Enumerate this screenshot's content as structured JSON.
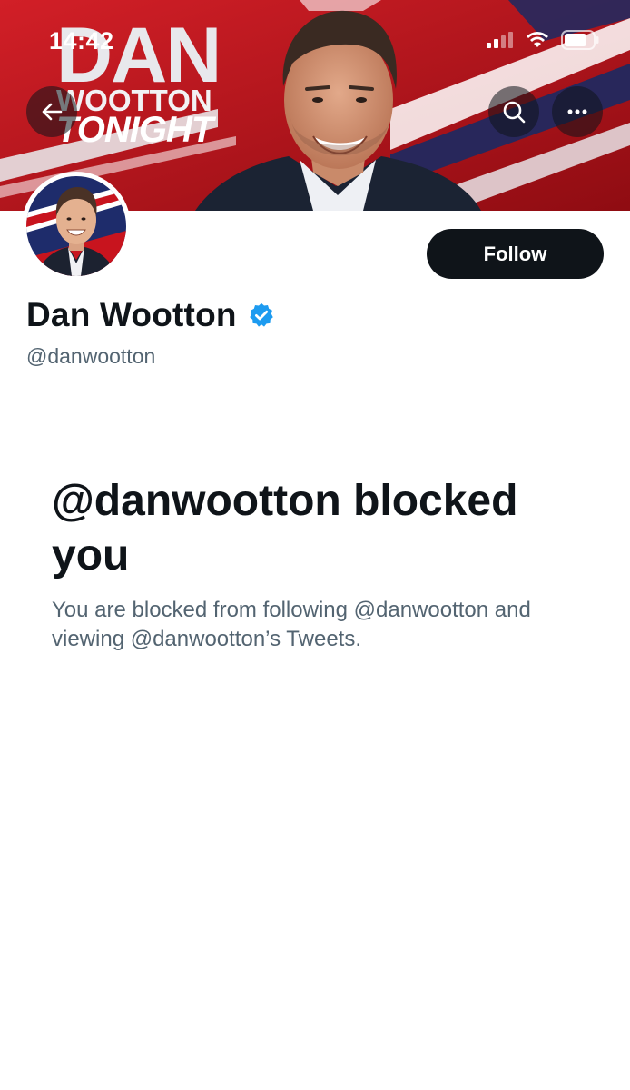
{
  "status_bar": {
    "time": "14:42"
  },
  "banner": {
    "line1": "DAN",
    "line2": "WOOTTON",
    "line3": "TONIGHT"
  },
  "navigation": {
    "back_icon": "arrow-left-icon",
    "search_icon": "search-icon",
    "more_icon": "more-horizontal-icon"
  },
  "profile": {
    "display_name": "Dan Wootton",
    "handle": "@danwootton",
    "verified": true,
    "verified_badge_color": "#1d9bf0",
    "follow_label": "Follow"
  },
  "blocked": {
    "title": "@danwootton blocked you",
    "description": "You are blocked from following @danwootton and viewing @danwootton’s Tweets."
  },
  "colors": {
    "text_primary": "#0f1419",
    "text_secondary": "#536471",
    "banner_red": "#c8141e",
    "follow_bg": "#0f1419"
  }
}
